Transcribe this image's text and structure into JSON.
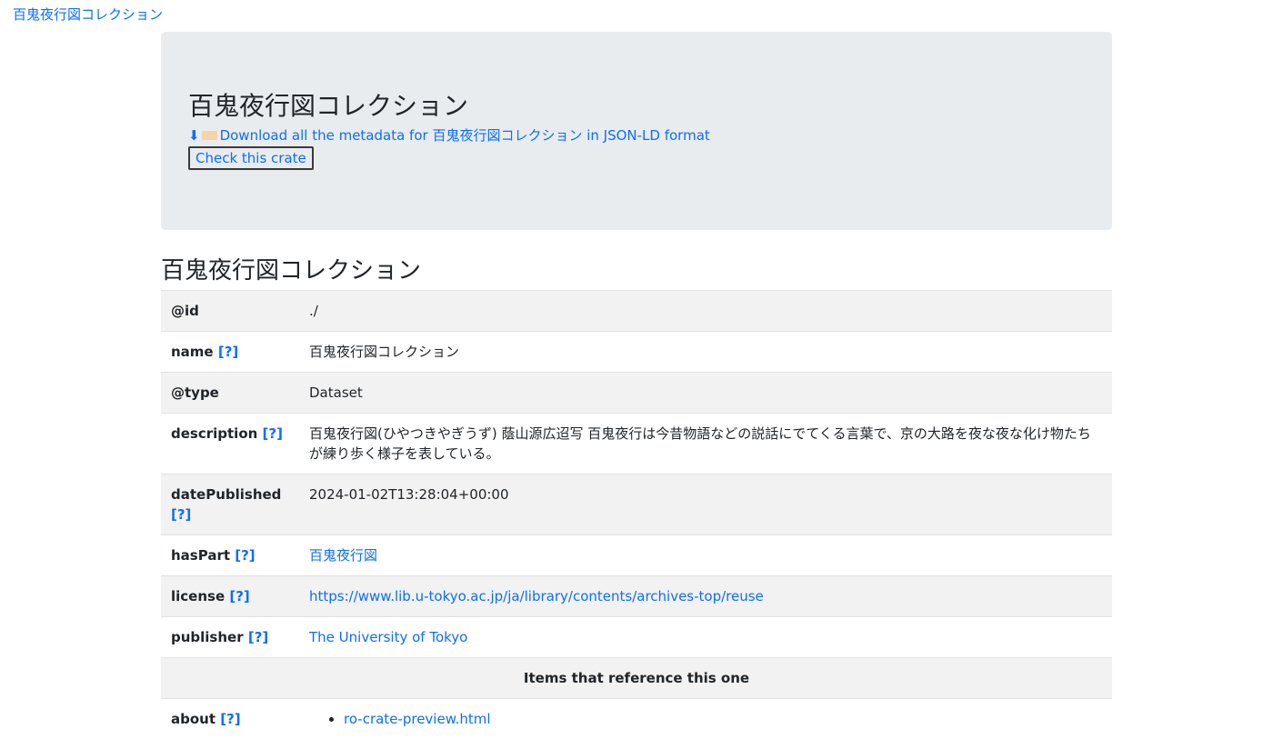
{
  "breadcrumb": {
    "label": "百鬼夜行図コレクション"
  },
  "jumbotron": {
    "title": "百鬼夜行図コレクション",
    "download_label": "Download all the metadata for 百鬼夜行図コレクション in JSON-LD format",
    "download_icon": "down-arrow-icon",
    "tag_icon": "label-tag-icon",
    "check_button_label": "Check this crate"
  },
  "section_title": "百鬼夜行図コレクション",
  "help_label": "[?]",
  "properties": {
    "id": {
      "key": "@id",
      "value": "./"
    },
    "name": {
      "key": "name",
      "value": "百鬼夜行図コレクション"
    },
    "type": {
      "key": "@type",
      "value": "Dataset"
    },
    "description": {
      "key": "description",
      "value": "百鬼夜行図(ひやつきやぎうず) 蔭山源広迢写 百鬼夜行は今昔物語などの説話にでてくる言葉で、京の大路を夜な夜な化け物たちが練り歩く様子を表している。"
    },
    "datePublished": {
      "key": "datePublished",
      "value": "2024-01-02T13:28:04+00:00"
    },
    "hasPart": {
      "key": "hasPart",
      "value": "百鬼夜行図"
    },
    "license": {
      "key": "license",
      "value": "https://www.lib.u-tokyo.ac.jp/ja/library/contents/archives-top/reuse"
    },
    "publisher": {
      "key": "publisher",
      "value": "The University of Tokyo"
    }
  },
  "references": {
    "heading": "Items that reference this one",
    "about": {
      "key": "about",
      "items": [
        "ro-crate-preview.html"
      ]
    }
  },
  "colors": {
    "link": "#0d6efd",
    "jumbotron_bg": "#e9ecef",
    "stripe": "#f2f2f2"
  }
}
